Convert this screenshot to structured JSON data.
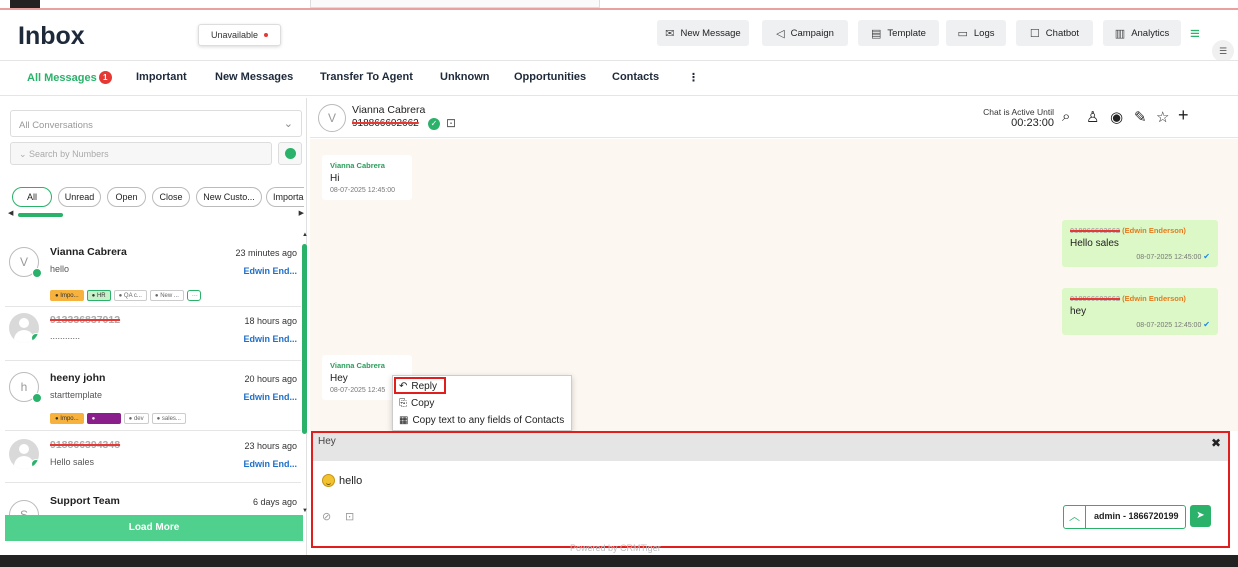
{
  "header": {
    "title": "Inbox",
    "status": "Unavailable",
    "buttons": [
      {
        "label": "New Message",
        "icon": "new-message-icon"
      },
      {
        "label": "Campaign",
        "icon": "campaign-icon"
      },
      {
        "label": "Template",
        "icon": "template-icon"
      },
      {
        "label": "Logs",
        "icon": "logs-icon"
      },
      {
        "label": "Chatbot",
        "icon": "chatbot-icon"
      },
      {
        "label": "Analytics",
        "icon": "analytics-icon"
      }
    ]
  },
  "tabs": [
    {
      "label": "All Messages",
      "badge": "1"
    },
    {
      "label": "Important"
    },
    {
      "label": "New Messages"
    },
    {
      "label": "Transfer To Agent"
    },
    {
      "label": "Unknown"
    },
    {
      "label": "Opportunities"
    },
    {
      "label": "Contacts"
    }
  ],
  "tabs_more": "⋮",
  "sidebar": {
    "conversation_select": "All Conversations",
    "search_placeholder": "Search by Numbers",
    "chips": [
      "All",
      "Unread",
      "Open",
      "Close",
      "New Custo...",
      "Importar"
    ],
    "conversations": [
      {
        "name": "Vianna Cabrera",
        "message": "hello",
        "time": "23 minutes ago",
        "agent": "Edwin End...",
        "avatar": "V",
        "tags": [
          "Impo...",
          "HR",
          "QA c...",
          "New ..."
        ]
      },
      {
        "name": "913336837012",
        "message": "............",
        "time": "18 hours ago",
        "agent": "Edwin End..."
      },
      {
        "name": "heeny john",
        "message": "starttemplate",
        "time": "20 hours ago",
        "agent": "Edwin End...",
        "avatar": "h",
        "tags": [
          "Impo...",
          "",
          "dev",
          "sales..."
        ]
      },
      {
        "name": "918866394348",
        "message": "Hello sales",
        "time": "23 hours ago",
        "agent": "Edwin End..."
      },
      {
        "name": "Support Team",
        "time": "6 days ago",
        "avatar": "S"
      }
    ],
    "load_more": "Load More"
  },
  "chat": {
    "contact_name": "Vianna Cabrera",
    "contact_phone": "918866602662",
    "contact_initial": "V",
    "active_label": "Chat is Active Until",
    "active_time": "00:23:00",
    "messages": [
      {
        "sender": "Vianna Cabrera",
        "text": "Hi",
        "time": "08-07-2025 12:45:00"
      },
      {
        "sender_number": "918866602662",
        "sender_name": "(Edwin Enderson)",
        "text": "Hello sales",
        "time": "08-07-2025 12:45:00"
      },
      {
        "sender_number": "918866602662",
        "sender_name": "(Edwin Enderson)",
        "text": "hey",
        "time": "08-07-2025 12:45:00"
      },
      {
        "sender": "Vianna Cabrera",
        "text": "Hey",
        "time": "08-07-2025 12:45"
      }
    ],
    "context_menu": {
      "reply": "Reply",
      "copy": "Copy",
      "copy_to_contacts": "Copy text to any fields of Contacts"
    },
    "reply_preview": "Hey",
    "composer_text": "hello",
    "sender_account": "admin - 1866720199"
  },
  "footer": {
    "powered_by": "Powered by CRMTiger"
  },
  "colors": {
    "accent": "#2ab26a",
    "highlight": "#e01e1e",
    "chat_bg": "#fdf7f1",
    "outgoing": "#dcf8c6"
  }
}
